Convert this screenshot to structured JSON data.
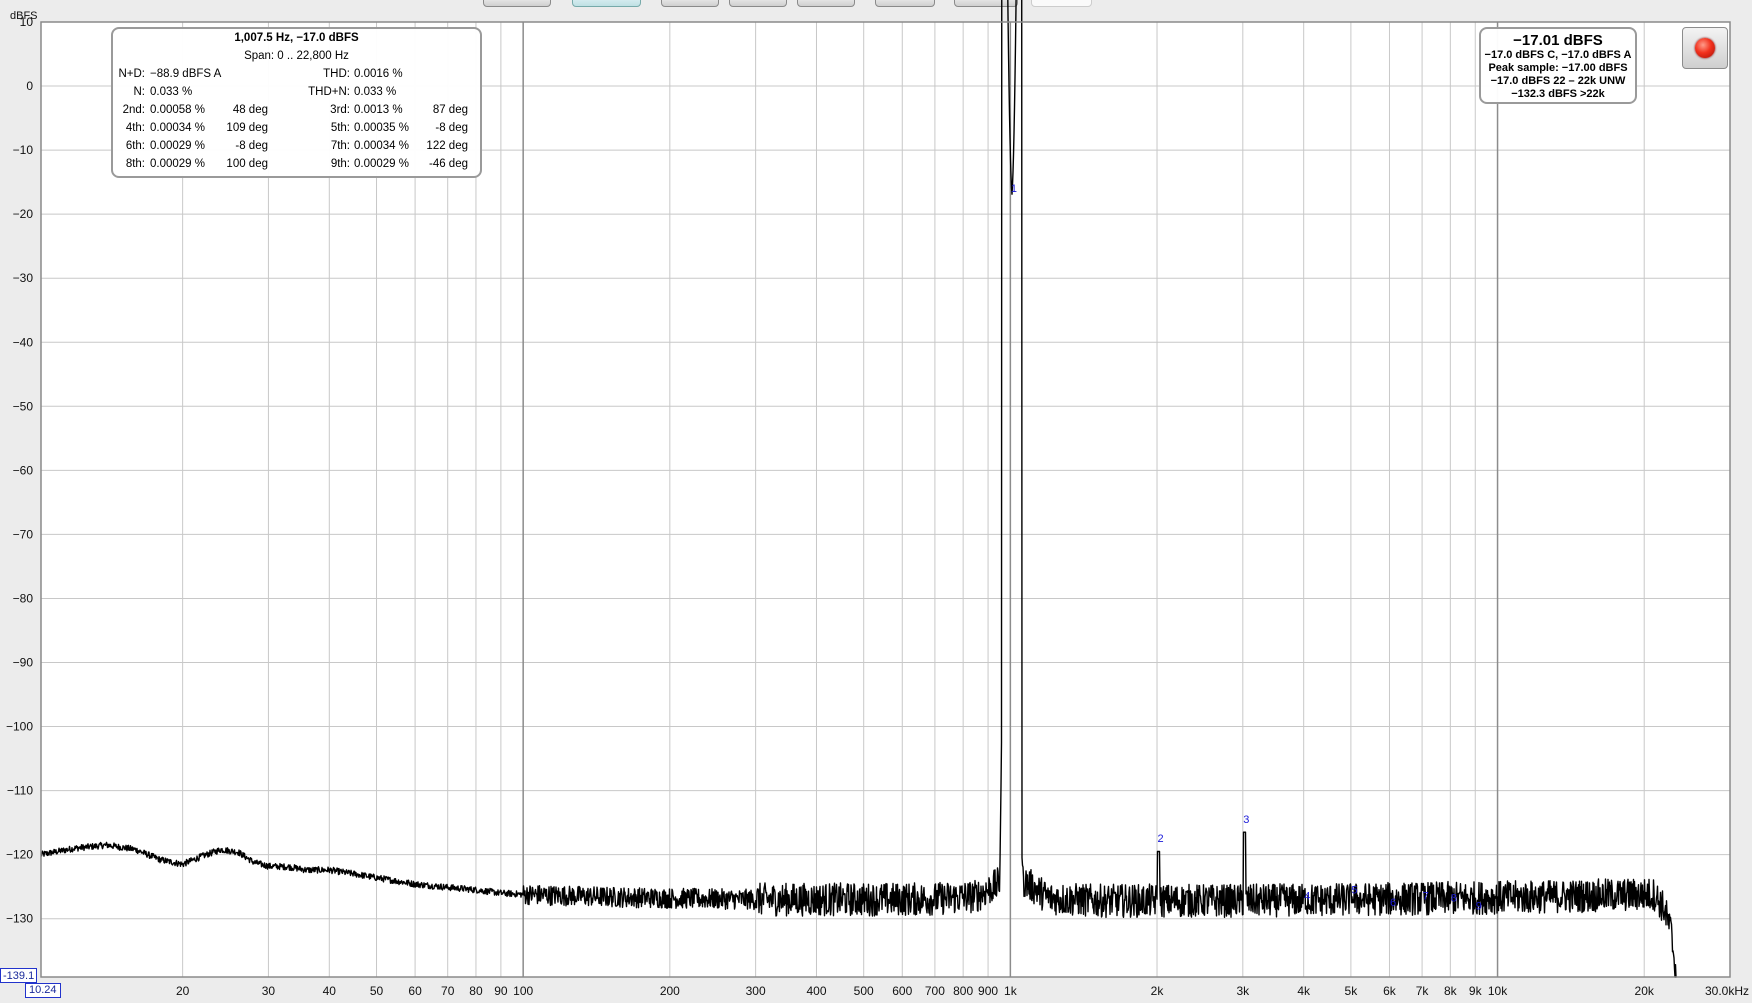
{
  "toolbar": {
    "buttons": [
      {
        "name": "toolbar-button-1",
        "state": "normal"
      },
      {
        "name": "toolbar-button-2",
        "state": "active"
      },
      {
        "name": "toolbar-button-3",
        "state": "normal"
      },
      {
        "name": "toolbar-button-4",
        "state": "normal"
      },
      {
        "name": "toolbar-button-5",
        "state": "normal"
      },
      {
        "name": "toolbar-button-6",
        "state": "normal"
      },
      {
        "name": "toolbar-button-7",
        "state": "normal"
      },
      {
        "name": "toolbar-button-8",
        "state": "blank"
      }
    ]
  },
  "info": {
    "header": "1,007.5 Hz, −17.0 dBFS",
    "span": "Span: 0 .. 22,800 Hz",
    "nd_label": "N+D:",
    "nd_value": "−88.9 dBFS A",
    "thd_label": "THD:",
    "thd_value": "0.0016 %",
    "n_label": "N:",
    "n_value": "0.033 %",
    "thdn_label": "THD+N:",
    "thdn_value": "0.033 %",
    "harmonics": [
      {
        "left_label": "2nd:",
        "left_value": "0.00058 %",
        "left_phase": "48 deg",
        "right_label": "3rd:",
        "right_value": "0.0013 %",
        "right_phase": "87 deg"
      },
      {
        "left_label": "4th:",
        "left_value": "0.00034 %",
        "left_phase": "109 deg",
        "right_label": "5th:",
        "right_value": "0.00035 %",
        "right_phase": "-8 deg"
      },
      {
        "left_label": "6th:",
        "left_value": "0.00029 %",
        "left_phase": "-8 deg",
        "right_label": "7th:",
        "right_value": "0.00034 %",
        "right_phase": "122 deg"
      },
      {
        "left_label": "8th:",
        "left_value": "0.00029 %",
        "left_phase": "100 deg",
        "right_label": "9th:",
        "right_value": "0.00029 %",
        "right_phase": "-46 deg"
      }
    ]
  },
  "level": {
    "main": "−17.01 dBFS",
    "line1": "−17.0 dBFS C, −17.0 dBFS A",
    "line2": "Peak sample: −17.00 dBFS",
    "line3": "−17.0 dBFS 22 – 22k UNW",
    "line4": "−132.3 dBFS >22k"
  },
  "cursor": {
    "y_readout": "-139.1",
    "x_readout": "10.24"
  },
  "colors": {
    "trace": "#000000",
    "grid": "#c8c8c8",
    "marker": "#1a1ad8",
    "plot_bg": "#ffffff",
    "record": "#f2311d"
  },
  "chart_data": {
    "type": "line",
    "ylabel": "dBFS",
    "xlabel": "",
    "x_scale": "log",
    "xlim": [
      10.24,
      30000
    ],
    "ylim": [
      -139.1,
      10
    ],
    "grid": true,
    "y_ticks": [
      10,
      0,
      -10,
      -20,
      -30,
      -40,
      -50,
      -60,
      -70,
      -80,
      -90,
      -100,
      -110,
      -120,
      -130
    ],
    "y_tick_labels": [
      "10",
      "0",
      "−10",
      "−20",
      "−30",
      "−40",
      "−50",
      "−60",
      "−70",
      "−80",
      "−90",
      "−100",
      "−110",
      "−120",
      "−130"
    ],
    "x_ticks": [
      20,
      30,
      40,
      50,
      60,
      70,
      80,
      90,
      100,
      200,
      300,
      400,
      500,
      600,
      700,
      800,
      900,
      1000,
      2000,
      3000,
      4000,
      5000,
      6000,
      7000,
      8000,
      9000,
      10000,
      20000,
      30000
    ],
    "x_tick_labels": [
      "20",
      "30",
      "40",
      "50",
      "60",
      "70",
      "80",
      "90",
      "100",
      "200",
      "300",
      "400",
      "500",
      "600",
      "700",
      "800",
      "900",
      "1k",
      "2k",
      "3k",
      "4k",
      "5k",
      "6k",
      "7k",
      "8k",
      "9k",
      "10k",
      "20k",
      "30.0kHz"
    ],
    "noise_floor": [
      [
        10.24,
        -120.0
      ],
      [
        12,
        -119.0
      ],
      [
        14,
        -118.5
      ],
      [
        16,
        -119.2
      ],
      [
        18,
        -120.8
      ],
      [
        20,
        -121.5
      ],
      [
        22,
        -120.2
      ],
      [
        24,
        -119.2
      ],
      [
        26,
        -119.6
      ],
      [
        28,
        -121.2
      ],
      [
        30,
        -121.8
      ],
      [
        33,
        -121.9
      ],
      [
        36,
        -122.4
      ],
      [
        40,
        -122.4
      ],
      [
        45,
        -123.0
      ],
      [
        50,
        -123.6
      ],
      [
        60,
        -124.6
      ],
      [
        70,
        -125.1
      ],
      [
        80,
        -125.5
      ],
      [
        90,
        -126.0
      ],
      [
        100,
        -126.2
      ],
      [
        150,
        -126.6
      ],
      [
        200,
        -126.8
      ],
      [
        300,
        -127.0
      ],
      [
        500,
        -127.0
      ],
      [
        700,
        -126.9
      ],
      [
        850,
        -126.5
      ],
      [
        950,
        -124.5
      ],
      [
        1000,
        -17.0
      ],
      [
        1060,
        -124.0
      ],
      [
        1200,
        -126.8
      ],
      [
        1500,
        -127.2
      ],
      [
        2000,
        -127.2
      ],
      [
        3000,
        -127.2
      ],
      [
        5000,
        -127.0
      ],
      [
        8000,
        -126.8
      ],
      [
        12000,
        -126.6
      ],
      [
        18000,
        -126.3
      ],
      [
        21000,
        -126.2
      ],
      [
        22000,
        -128.5
      ],
      [
        22700,
        -132.0
      ],
      [
        23300,
        -139.1
      ]
    ],
    "harmonic_markers": [
      {
        "label": "1",
        "freq": 1007.5,
        "db": -17.0
      },
      {
        "label": "2",
        "freq": 2015,
        "db": -118.5
      },
      {
        "label": "3",
        "freq": 3022,
        "db": -115.5
      },
      {
        "label": "4",
        "freq": 4030,
        "db": -127.5
      },
      {
        "label": "5",
        "freq": 5037,
        "db": -126.5
      },
      {
        "label": "6",
        "freq": 6045,
        "db": -128.5
      },
      {
        "label": "7",
        "freq": 7052,
        "db": -127.5
      },
      {
        "label": "8",
        "freq": 8060,
        "db": -127.8
      },
      {
        "label": "9",
        "freq": 9067,
        "db": -129.0
      }
    ]
  }
}
